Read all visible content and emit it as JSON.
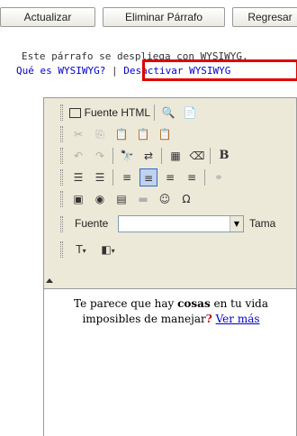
{
  "buttons": {
    "actualizar": "Actualizar",
    "eliminar": "Eliminar Párrafo",
    "regresar": "Regresar"
  },
  "info": {
    "line1": "Este párrafo se despliega con WYSIWYG.",
    "link_what": "Qué es WYSIWYG?",
    "separator": "|",
    "link_disable": "Desactivar WYSIWYG"
  },
  "editor": {
    "toolbar": {
      "source_label": "Fuente HTML",
      "font_label": "Fuente",
      "font_value": "",
      "size_label": "Tama"
    },
    "content": {
      "text_before": "Te parece que hay ",
      "bold_word": "cosas",
      "text_middle": " en tu vida imposibles de manejar",
      "question_mark": "?",
      "link_text": "Ver más"
    }
  }
}
